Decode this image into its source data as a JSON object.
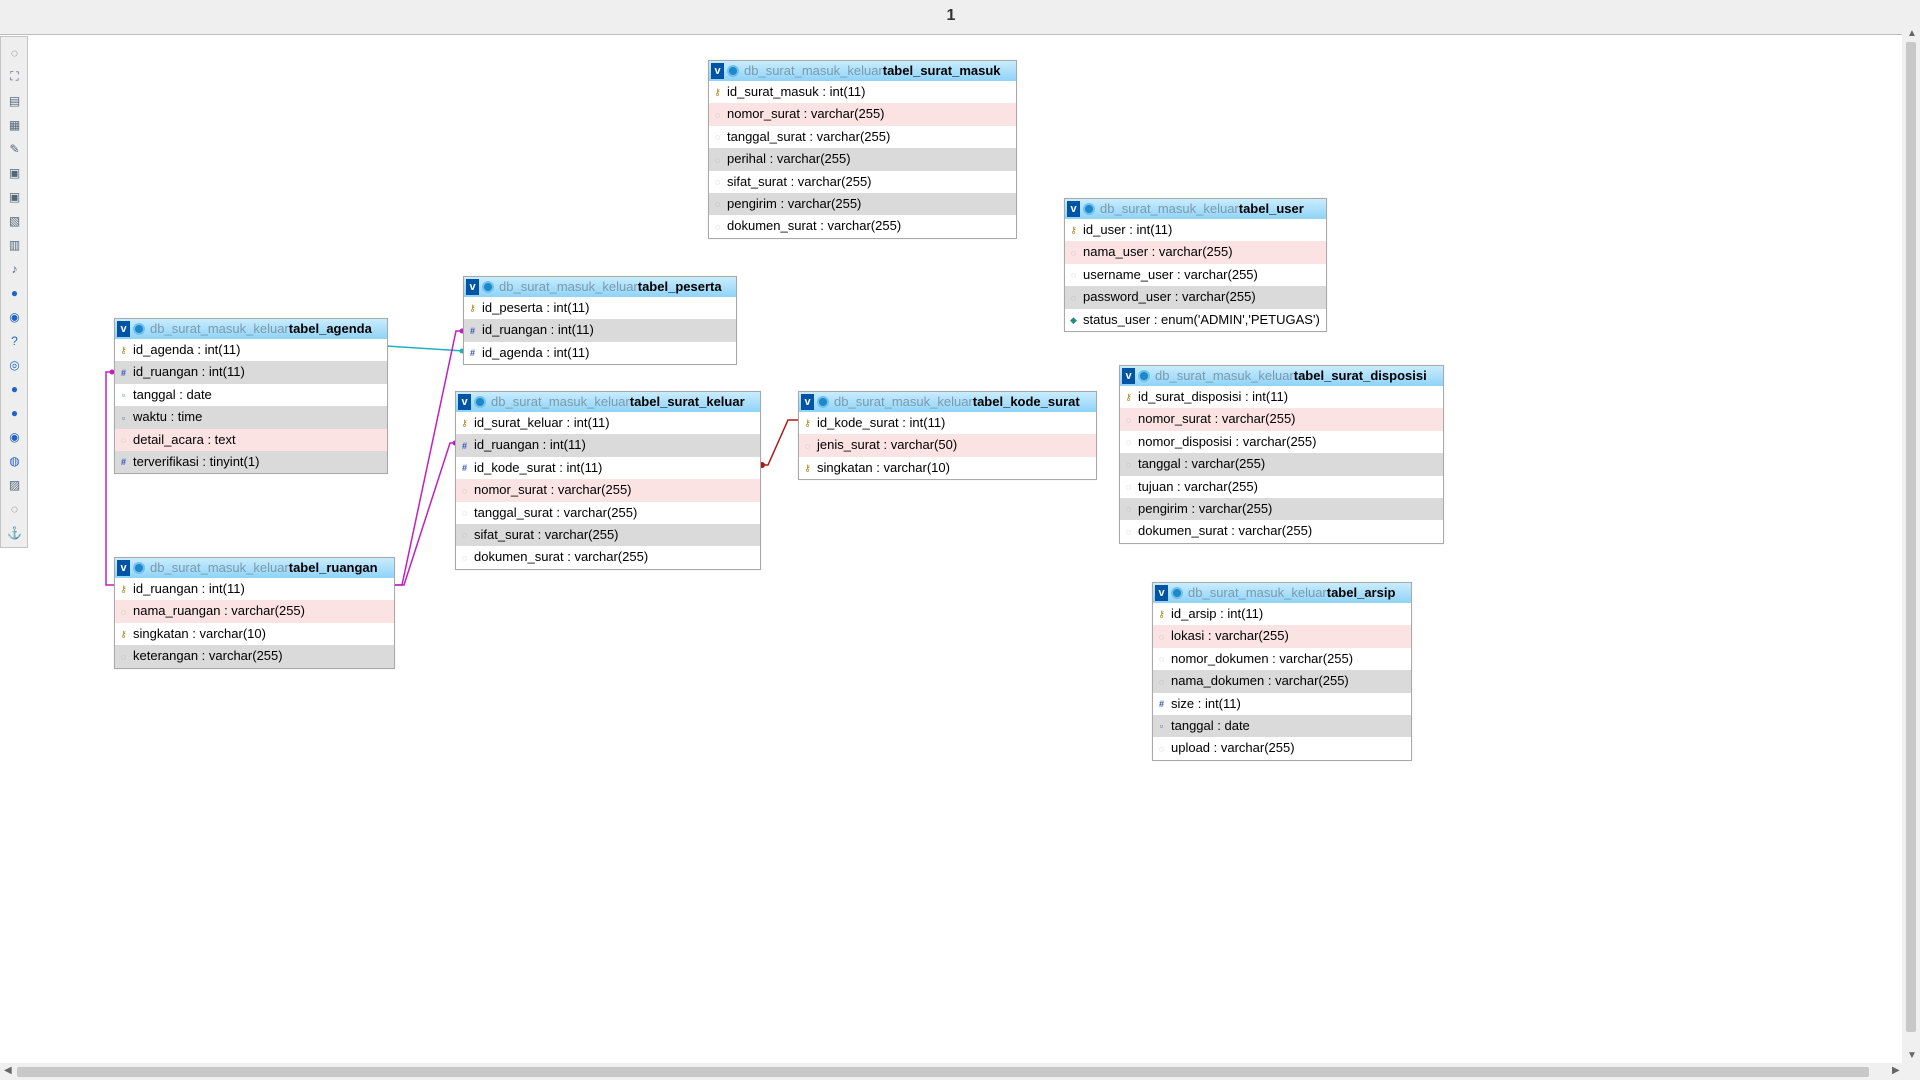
{
  "header": {
    "page_number": "1"
  },
  "colors": {
    "header_gradient_top": "#c9ecfe",
    "header_gradient_bottom": "#8fd3f7",
    "relation_magenta": "#c020c0",
    "relation_cyan": "#20b0c0",
    "relation_red": "#b01818",
    "highlight_row": "#fbe3e3",
    "alt_row": "#dadada"
  },
  "toolbar": {
    "icons": [
      "circle-icon",
      "fit-screen-icon",
      "add-page-icon",
      "add-table-icon",
      "edit-icon",
      "save-icon",
      "save-as-icon",
      "delete-page-icon",
      "page-icon",
      "music-note-icon",
      "help-icon",
      "refresh-icon",
      "question-icon",
      "relation-icon",
      "info-icon",
      "arrow-down-icon",
      "toggle-icon",
      "export-icon",
      "image-icon",
      "help-circle-icon",
      "anchor-icon"
    ]
  },
  "tables": {
    "surat_masuk": {
      "db": "db_surat_masuk_keluar",
      "name": "tabel_surat_masuk",
      "columns": [
        "id_surat_masuk : int(11)",
        "nomor_surat : varchar(255)",
        "tanggal_surat : varchar(255)",
        "perihal : varchar(255)",
        "sifat_surat : varchar(255)",
        "pengirim : varchar(255)",
        "dokumen_surat : varchar(255)"
      ]
    },
    "user": {
      "db": "db_surat_masuk_keluar",
      "name": "tabel_user",
      "columns": [
        "id_user : int(11)",
        "nama_user : varchar(255)",
        "username_user : varchar(255)",
        "password_user : varchar(255)",
        "status_user : enum('ADMIN','PETUGAS')"
      ]
    },
    "peserta": {
      "db": "db_surat_masuk_keluar",
      "name": "tabel_peserta",
      "columns": [
        "id_peserta : int(11)",
        "id_ruangan : int(11)",
        "id_agenda : int(11)"
      ]
    },
    "agenda": {
      "db": "db_surat_masuk_keluar",
      "name": "tabel_agenda",
      "columns": [
        "id_agenda : int(11)",
        "id_ruangan : int(11)",
        "tanggal : date",
        "waktu : time",
        "detail_acara : text",
        "terverifikasi : tinyint(1)"
      ]
    },
    "surat_keluar": {
      "db": "db_surat_masuk_keluar",
      "name": "tabel_surat_keluar",
      "columns": [
        "id_surat_keluar : int(11)",
        "id_ruangan : int(11)",
        "id_kode_surat : int(11)",
        "nomor_surat : varchar(255)",
        "tanggal_surat : varchar(255)",
        "sifat_surat : varchar(255)",
        "dokumen_surat : varchar(255)"
      ]
    },
    "kode_surat": {
      "db": "db_surat_masuk_keluar",
      "name": "tabel_kode_surat",
      "columns": [
        "id_kode_surat : int(11)",
        "jenis_surat : varchar(50)",
        "singkatan : varchar(10)"
      ]
    },
    "surat_disposisi": {
      "db": "db_surat_masuk_keluar",
      "name": "tabel_surat_disposisi",
      "columns": [
        "id_surat_disposisi : int(11)",
        "nomor_surat : varchar(255)",
        "nomor_disposisi : varchar(255)",
        "tanggal : varchar(255)",
        "tujuan : varchar(255)",
        "pengirim : varchar(255)",
        "dokumen_surat : varchar(255)"
      ]
    },
    "ruangan": {
      "db": "db_surat_masuk_keluar",
      "name": "tabel_ruangan",
      "columns": [
        "id_ruangan : int(11)",
        "nama_ruangan : varchar(255)",
        "singkatan : varchar(10)",
        "keterangan : varchar(255)"
      ]
    },
    "arsip": {
      "db": "db_surat_masuk_keluar",
      "name": "tabel_arsip",
      "columns": [
        "id_arsip : int(11)",
        "lokasi : varchar(255)",
        "nomor_dokumen : varchar(255)",
        "nama_dokumen : varchar(255)",
        "size : int(11)",
        "tanggal : date",
        "upload : varchar(255)"
      ]
    }
  }
}
